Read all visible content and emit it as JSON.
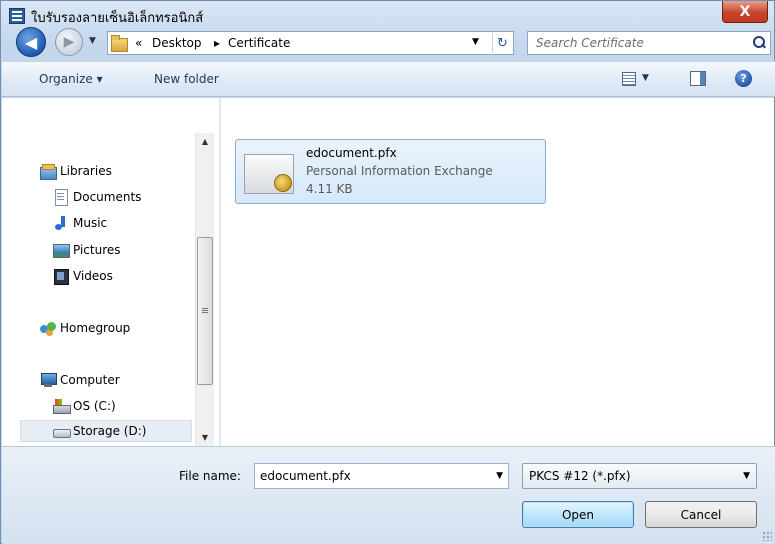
{
  "window": {
    "title": "ใบรับรองลายเซ็นอิเล็กทรอนิกส์",
    "close_glyph": "X"
  },
  "address_bar": {
    "back_glyph": "◀",
    "forward_glyph": "▶",
    "prefix": "«",
    "crumbs": [
      "Desktop",
      "Certificate"
    ],
    "separator": "▸"
  },
  "search": {
    "placeholder": "Search Certificate"
  },
  "toolbar": {
    "organize_label": "Organize ▾",
    "new_folder_label": "New folder",
    "help_glyph": "?"
  },
  "nav": {
    "libraries": "Libraries",
    "documents": "Documents",
    "music": "Music",
    "pictures": "Pictures",
    "videos": "Videos",
    "homegroup": "Homegroup",
    "computer": "Computer",
    "drive_os": "OS (C:)",
    "drive_storage": "Storage (D:)"
  },
  "files": [
    {
      "name": "edocument.pfx",
      "type": "Personal Information Exchange",
      "size": "4.11 KB"
    }
  ],
  "footer": {
    "file_name_label": "File name:",
    "file_name_value": "edocument.pfx",
    "file_type_value": "PKCS #12 (*.pfx)",
    "open_label": "Open",
    "cancel_label": "Cancel"
  },
  "colors": {
    "accent": "#3c7fb1",
    "selection": "#d6e8f9",
    "close": "#c8452c"
  }
}
